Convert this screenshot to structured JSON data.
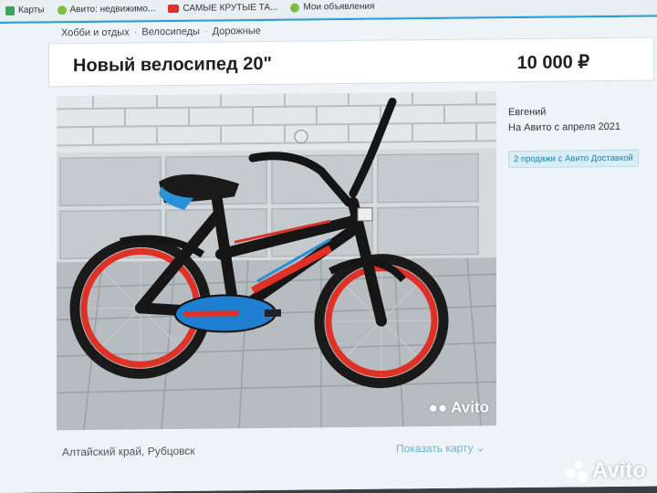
{
  "bookmarks": [
    {
      "label": "Карты",
      "icon": "maps-icon",
      "color": "#3aa35b"
    },
    {
      "label": "Авито: недвижимо...",
      "icon": "avito-icon",
      "color": "#7fbf3f"
    },
    {
      "label": "САМЫЕ КРУТЫЕ ТА...",
      "icon": "youtube-icon",
      "color": "#e52d27"
    },
    {
      "label": "Мои объявления",
      "icon": "avito-icon",
      "color": "#7fbf3f"
    }
  ],
  "breadcrumb": [
    "Хобби и отдых",
    "Велосипеды",
    "Дорожные"
  ],
  "breadcrumb_separator": "·",
  "listing": {
    "title": "Новый велосипед 20\"",
    "price": "10 000 ₽"
  },
  "seller": {
    "name": "Евгений",
    "since": "На Авито с апреля 2021",
    "badge": "2 продажи с Авито Доставкой"
  },
  "photo": {
    "watermark": "Avito"
  },
  "location": "Алтайский край, Рубцовск",
  "map_link": "Показать карту",
  "corner_logo": "Avito"
}
